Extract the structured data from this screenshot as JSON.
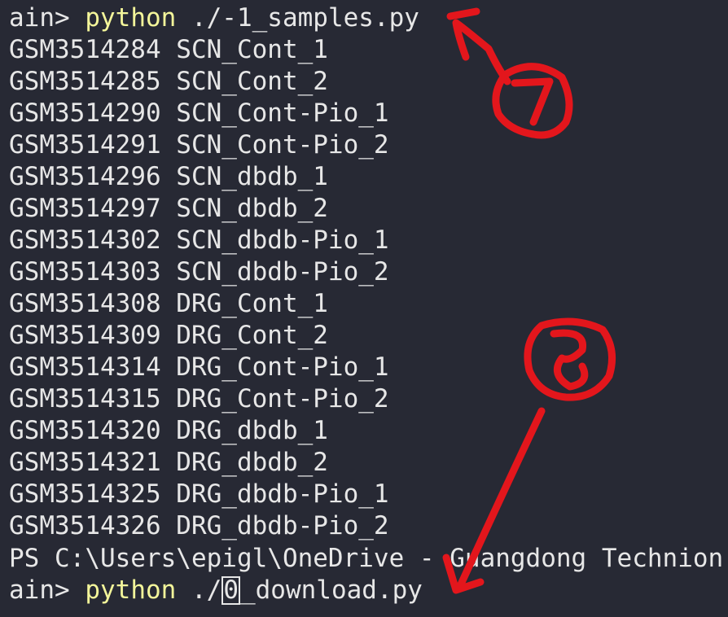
{
  "terminal": {
    "prompt_suffix": "ain> ",
    "first_command": {
      "cmd": "python",
      "args": " ./-1_samples.py"
    },
    "output_lines": [
      "GSM3514284 SCN_Cont_1",
      "GSM3514285 SCN_Cont_2",
      "GSM3514290 SCN_Cont-Pio_1",
      "GSM3514291 SCN_Cont-Pio_2",
      "GSM3514296 SCN_dbdb_1",
      "GSM3514297 SCN_dbdb_2",
      "GSM3514302 SCN_dbdb-Pio_1",
      "GSM3514303 SCN_dbdb-Pio_2",
      "GSM3514308 DRG_Cont_1",
      "GSM3514309 DRG_Cont_2",
      "GSM3514314 DRG_Cont-Pio_1",
      "GSM3514315 DRG_Cont-Pio_2",
      "GSM3514320 DRG_dbdb_1",
      "GSM3514321 DRG_dbdb_2",
      "GSM3514325 DRG_dbdb-Pio_1",
      "GSM3514326 DRG_dbdb-Pio_2"
    ],
    "ps_line": "PS C:\\Users\\epigl\\OneDrive - Guangdong Technion",
    "second_command": {
      "cmd": "python",
      "args_before_cursor": " ./",
      "cursor_char": "0",
      "args_after_cursor": "_download.py"
    },
    "colors": {
      "background": "#272934",
      "text": "#e7e7e7",
      "command": "#f3f59a",
      "annotation": "#e3161c"
    }
  },
  "annotations": {
    "mark_7": "7",
    "mark_8": "8"
  }
}
